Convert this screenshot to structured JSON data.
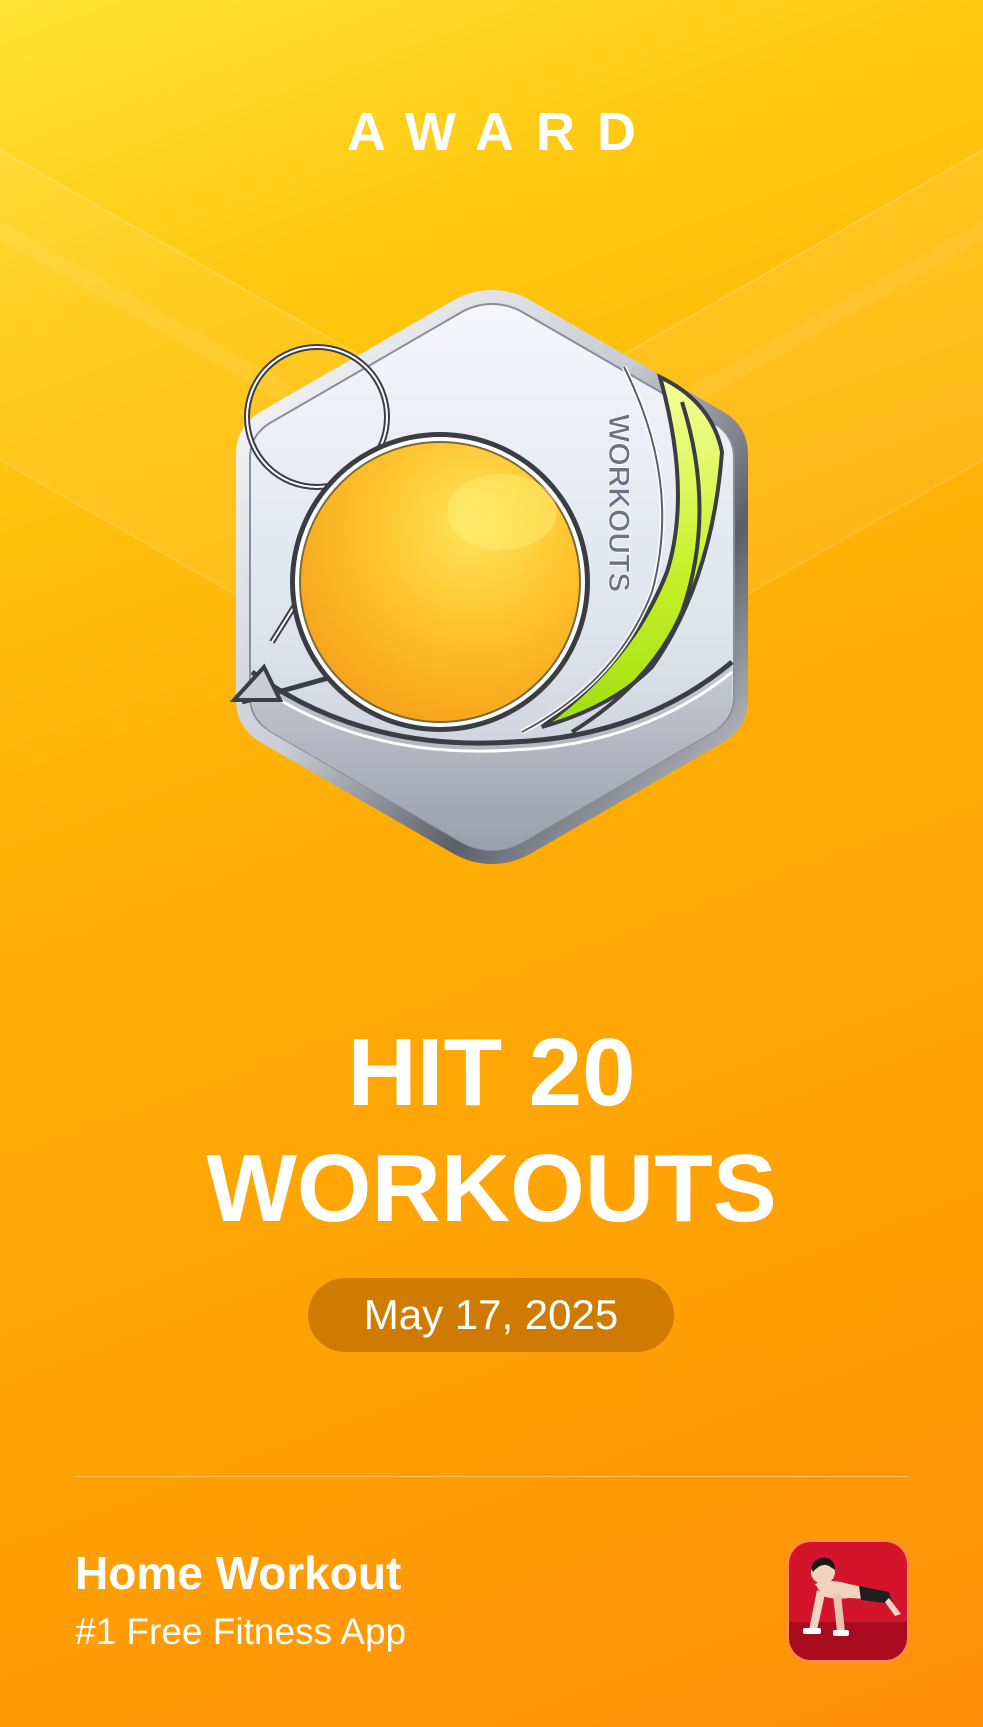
{
  "header": {
    "label": "AWARD"
  },
  "badge": {
    "engraving": "WORKOUTS",
    "icon": "hexagon-medal-icon"
  },
  "achievement": {
    "line1": "HIT 20",
    "line2": "WORKOUTS",
    "date": "May 17, 2025"
  },
  "footer": {
    "app_name": "Home Workout",
    "tagline": "#1 Free Fitness App",
    "app_icon": "pushup-man-app-icon"
  },
  "colors": {
    "background_top": "#FFE436",
    "background_bottom": "#FF8F08",
    "date_pill": "#A85C00",
    "app_icon_bg": "#D4142A"
  }
}
